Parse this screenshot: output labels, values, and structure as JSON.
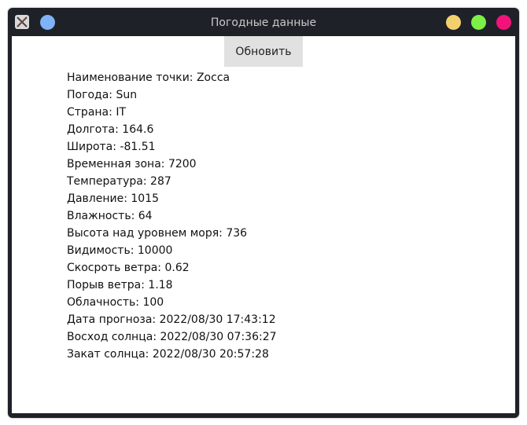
{
  "window": {
    "title": "Погодные данные",
    "colors": {
      "frame": "#1f2128",
      "pin": "#7fb2f7",
      "minimize": "#f2d06e",
      "maximize": "#7cf046",
      "close": "#f2137a"
    }
  },
  "toolbar": {
    "refresh_label": "Обновить"
  },
  "weather": {
    "fields": [
      {
        "label": "Наименование точки",
        "value": "Zocca"
      },
      {
        "label": "Погода",
        "value": "Sun"
      },
      {
        "label": "Страна",
        "value": "IT"
      },
      {
        "label": "Долгота",
        "value": "164.6"
      },
      {
        "label": "Широта",
        "value": "-81.51"
      },
      {
        "label": "Временная зона",
        "value": "7200"
      },
      {
        "label": "Температура",
        "value": "287"
      },
      {
        "label": "Давление",
        "value": "1015"
      },
      {
        "label": "Влажность",
        "value": "64"
      },
      {
        "label": "Высота над уровнем моря",
        "value": "736"
      },
      {
        "label": "Видимость",
        "value": "10000"
      },
      {
        "label": "Скосроть ветра",
        "value": "0.62"
      },
      {
        "label": "Порыв ветра",
        "value": "1.18"
      },
      {
        "label": "Облачность",
        "value": "100"
      },
      {
        "label": "Дата прогноза",
        "value": "2022/08/30 17:43:12"
      },
      {
        "label": "Восход солнца",
        "value": "2022/08/30 07:36:27"
      },
      {
        "label": "Закат солнца",
        "value": "2022/08/30 20:57:28"
      }
    ]
  }
}
